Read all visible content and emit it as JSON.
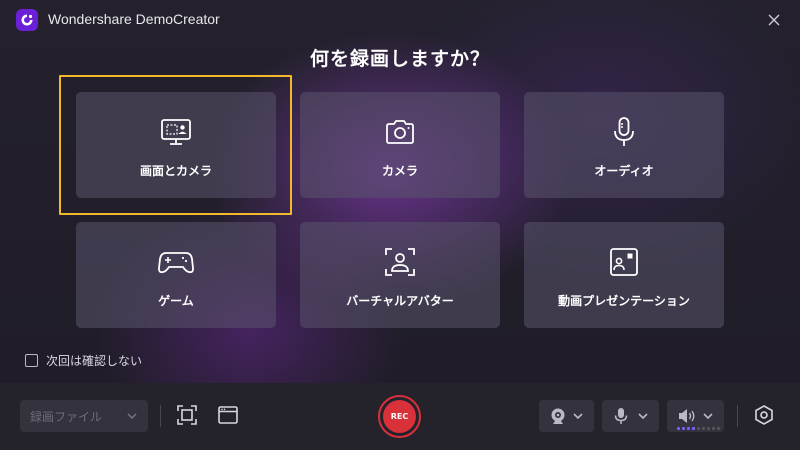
{
  "window": {
    "title": "Wondershare DemoCreator"
  },
  "heading": "何を録画しますか？",
  "tiles": [
    {
      "label": "画面とカメラ",
      "icon": "screen-camera-icon",
      "selected": true
    },
    {
      "label": "カメラ",
      "icon": "camera-icon",
      "selected": false
    },
    {
      "label": "オーディオ",
      "icon": "microphone-icon",
      "selected": false
    },
    {
      "label": "ゲーム",
      "icon": "gamepad-icon",
      "selected": false
    },
    {
      "label": "バーチャルアバター",
      "icon": "avatar-icon",
      "selected": false
    },
    {
      "label": "動画プレゼンテーション",
      "icon": "presentation-icon",
      "selected": false
    }
  ],
  "dont_ask_again": {
    "label": "次回は確認しない",
    "checked": false
  },
  "toolbar": {
    "mode_select": "録画ファイル",
    "rec_label": "REC"
  },
  "colors": {
    "accent_selection": "#f3b82b",
    "record_red": "#d8313a",
    "brand_purple": "#6b1fd6",
    "volume_active": "#7a5cff"
  }
}
